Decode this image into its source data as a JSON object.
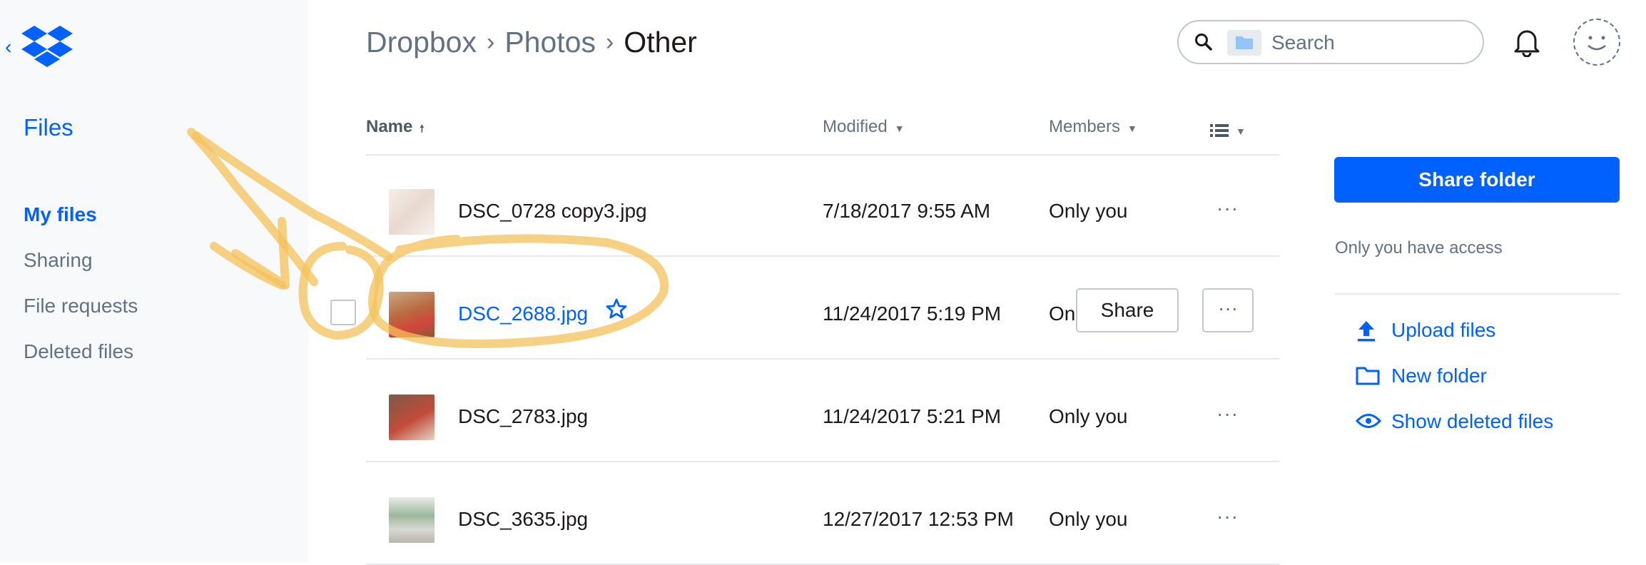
{
  "sidebar": {
    "files_label": "Files",
    "items": [
      {
        "label": "My files",
        "active": true
      },
      {
        "label": "Sharing",
        "active": false
      },
      {
        "label": "File requests",
        "active": false
      },
      {
        "label": "Deleted files",
        "active": false
      }
    ]
  },
  "header": {
    "breadcrumb": [
      "Dropbox",
      "Photos",
      "Other"
    ],
    "search_placeholder": "Search"
  },
  "table": {
    "columns": {
      "name": "Name",
      "modified": "Modified",
      "members": "Members"
    },
    "rows": [
      {
        "name": "DSC_0728 copy3.jpg",
        "modified": "7/18/2017 9:55 AM",
        "members": "Only you",
        "more": "···"
      },
      {
        "name": "DSC_2688.jpg",
        "modified": "11/24/2017 5:19 PM",
        "members": "On",
        "share": "Share",
        "more": "···"
      },
      {
        "name": "DSC_2783.jpg",
        "modified": "11/24/2017 5:21 PM",
        "members": "Only you",
        "more": "···"
      },
      {
        "name": "DSC_3635.jpg",
        "modified": "12/27/2017 12:53 PM",
        "members": "Only you",
        "more": "···"
      }
    ]
  },
  "right_panel": {
    "share_folder": "Share folder",
    "access": "Only you have access",
    "actions": [
      {
        "label": "Upload files",
        "icon": "upload-icon"
      },
      {
        "label": "New folder",
        "icon": "folder-icon"
      },
      {
        "label": "Show deleted files",
        "icon": "eye-icon"
      }
    ]
  },
  "colors": {
    "accent": "#0061fe",
    "annotation": "#f4c25a",
    "sidebar_bg": "#f7f9fa"
  }
}
